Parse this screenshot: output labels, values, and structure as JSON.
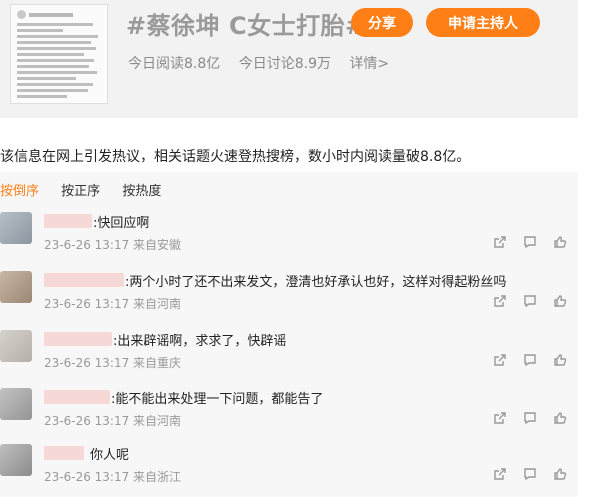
{
  "topic": {
    "title": "#蔡徐坤 C女士打胎#",
    "share_label": "分享",
    "host_label": "申请主持人",
    "reads": "今日阅读8.8亿",
    "discussions": "今日讨论8.9万",
    "details": "详情>",
    "accent_color": "#ff7f17"
  },
  "article": {
    "text": "该信息在网上引发热议，相关话题火速登热搜榜，数小时内阅读量破8.8亿。"
  },
  "comments_section": {
    "sort_tabs": [
      {
        "label": "按倒序",
        "active": true
      },
      {
        "label": "按正序",
        "active": false
      },
      {
        "label": "按热度",
        "active": false
      }
    ],
    "comments": [
      {
        "text": ":快回应啊",
        "date": "23-6-26 13:17",
        "source": "来自安徽"
      },
      {
        "text": ":两个小时了还不出来发文，澄清也好承认也好，这样对得起粉丝吗",
        "date": "23-6-26 13:17",
        "source": "来自河南"
      },
      {
        "text": ":出来辟谣啊，求求了，快辟谣",
        "date": "23-6-26 13:17",
        "source": "来自重庆"
      },
      {
        "text": ":能不能出来处理一下问题，都能告了",
        "date": "23-6-26 13:17",
        "source": "来自河南"
      },
      {
        "text": "你人呢",
        "date": "23-6-26 13:17",
        "source": "来自浙江"
      }
    ],
    "action_icons": [
      "share-icon",
      "comment-icon",
      "like-icon"
    ]
  }
}
